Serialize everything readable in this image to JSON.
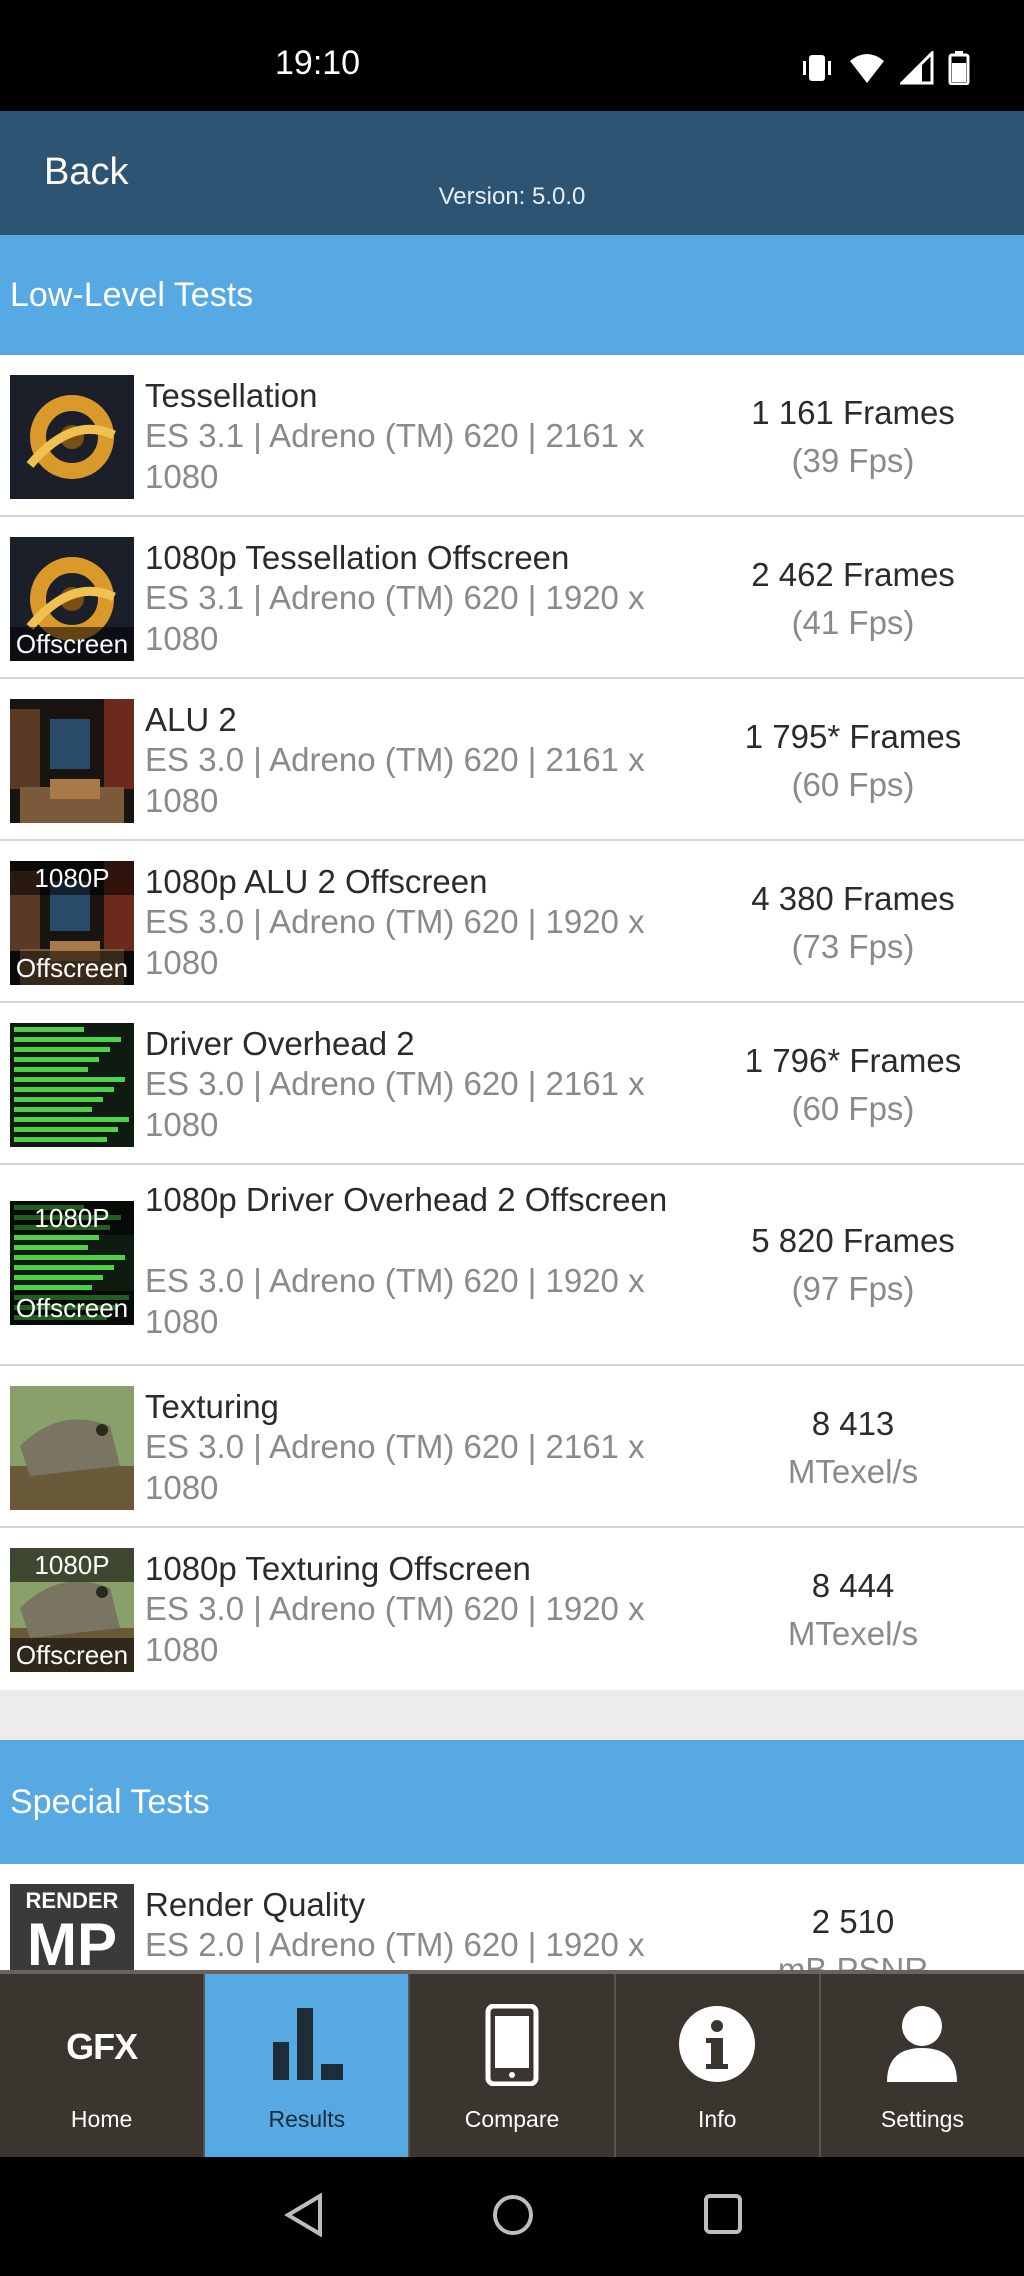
{
  "status_bar": {
    "time": "19:10"
  },
  "header": {
    "back_label": "Back",
    "version": "Version: 5.0.0"
  },
  "sections": [
    {
      "title": "Low-Level Tests"
    },
    {
      "title": "Special Tests"
    }
  ],
  "tests": [
    {
      "name": "Tessellation",
      "desc": "ES 3.1 | Adreno (TM) 620 | 2161 x 1080",
      "score": "1 161 Frames",
      "sub": "(39 Fps)",
      "thumb": "tessellation-thumbnail",
      "caption_top": "",
      "caption_bottom": ""
    },
    {
      "name": "1080p Tessellation Offscreen",
      "desc": "ES 3.1 | Adreno (TM) 620 | 1920 x 1080",
      "score": "2 462 Frames",
      "sub": "(41 Fps)",
      "thumb": "tessellation-thumbnail",
      "caption_top": "",
      "caption_bottom": "Offscreen"
    },
    {
      "name": "ALU 2",
      "desc": "ES 3.0 | Adreno (TM) 620 | 2161 x 1080",
      "score": "1 795* Frames",
      "sub": "(60 Fps)",
      "thumb": "alu-thumbnail",
      "caption_top": "",
      "caption_bottom": ""
    },
    {
      "name": "1080p ALU 2 Offscreen",
      "desc": "ES 3.0 | Adreno (TM) 620 | 1920 x 1080",
      "score": "4 380 Frames",
      "sub": "(73 Fps)",
      "thumb": "alu-thumbnail",
      "caption_top": "1080P",
      "caption_bottom": "Offscreen"
    },
    {
      "name": "Driver Overhead 2",
      "desc": "ES 3.0 | Adreno (TM) 620 | 2161 x 1080",
      "score": "1 796* Frames",
      "sub": "(60 Fps)",
      "thumb": "driver-thumbnail",
      "caption_top": "",
      "caption_bottom": ""
    },
    {
      "name": "1080p Driver Overhead 2 Offscreen",
      "desc": "ES 3.0 | Adreno (TM) 620 | 1920 x 1080",
      "score": "5 820 Frames",
      "sub": "(97 Fps)",
      "thumb": "driver-thumbnail",
      "caption_top": "1080P",
      "caption_bottom": "Offscreen"
    },
    {
      "name": "Texturing",
      "desc": "ES 3.0 | Adreno (TM) 620 | 2161 x 1080",
      "score": "8 413",
      "sub": "MTexel/s",
      "thumb": "texturing-thumbnail",
      "caption_top": "",
      "caption_bottom": ""
    },
    {
      "name": "1080p Texturing Offscreen",
      "desc": "ES 3.0 | Adreno (TM) 620 | 1920 x 1080",
      "score": "8 444",
      "sub": "MTexel/s",
      "thumb": "texturing-thumbnail",
      "caption_top": "1080P",
      "caption_bottom": "Offscreen"
    },
    {
      "name": "Render Quality",
      "desc": "ES 2.0 | Adreno (TM) 620 | 1920 x",
      "score": "2 510",
      "sub": "mB PSNR",
      "thumb": "render-quality-thumbnail",
      "caption_top": "RENDER",
      "caption_bottom": "MP"
    }
  ],
  "tabs": [
    {
      "label": "Home",
      "icon": "gfx-logo-icon",
      "logo_text": "GFX"
    },
    {
      "label": "Results",
      "icon": "bar-chart-icon"
    },
    {
      "label": "Compare",
      "icon": "phone-icon"
    },
    {
      "label": "Info",
      "icon": "info-icon"
    },
    {
      "label": "Settings",
      "icon": "user-icon"
    }
  ],
  "colors": {
    "header": "#2d5573",
    "section": "#56a9e3",
    "tab_bar": "#3b3530",
    "tab_active": "#56a9e3"
  }
}
